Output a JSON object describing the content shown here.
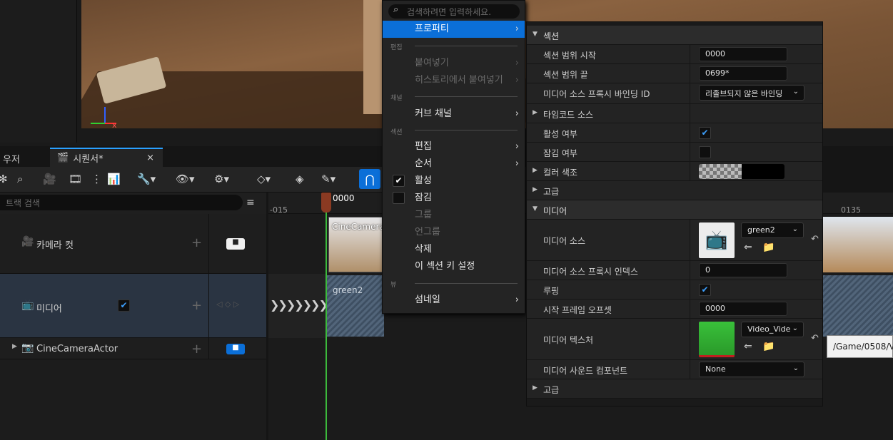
{
  "tabs": {
    "left_partial": "우저",
    "sequencer": "시퀀서*",
    "sequencer_icon": "clapperboard-icon",
    "close": "×"
  },
  "track_search": {
    "placeholder": "트랙 검색"
  },
  "tracks": [
    {
      "label": "카메라 컷",
      "icon": "camera-cut-icon"
    },
    {
      "label": "미디어",
      "icon": "tv-icon",
      "active_checked": true
    },
    {
      "label": "CineCameraActor",
      "icon": "camera-icon"
    }
  ],
  "ruler": {
    "start": "-015",
    "current": "0000",
    "end": "0135"
  },
  "clips": {
    "camera_clip": "CineCamera",
    "media_clip": "green2"
  },
  "context_menu": {
    "search_placeholder": "검색하려면 입력하세요.",
    "items": {
      "properties": "프로퍼티",
      "section_edit": "편집",
      "paste": "붙여넣기",
      "paste_history": "히스토리에서 붙여넣기",
      "section_channel": "채널",
      "curve_channel": "커브 채널",
      "section_section": "섹션",
      "edit": "편집",
      "order": "순서",
      "active": "활성",
      "lock": "잠김",
      "group": "그룹",
      "ungroup": "언그룹",
      "delete": "삭제",
      "key_section": "이 섹션 키 설정",
      "section_view": "뷰",
      "thumbnail": "섬네일"
    }
  },
  "details": {
    "section_header": "섹션",
    "range_start_label": "섹션 범위 시작",
    "range_start_value": "0000",
    "range_end_label": "섹션 범위 끝",
    "range_end_value": "0699*",
    "proxy_binding_label": "미디어 소스 프록시 바인딩 ID",
    "proxy_binding_value": "리졸브되지 않은 바인딩",
    "timecode_label": "타임코드 소스",
    "active_label": "활성 여부",
    "active_checked": true,
    "locked_label": "잠김 여부",
    "locked_checked": false,
    "color_tint_label": "컬러 색조",
    "advanced_1": "고급",
    "media_header": "미디어",
    "media_source_label": "미디어 소스",
    "media_source_value": "green2",
    "proxy_index_label": "미디어 소스 프록시 인덱스",
    "proxy_index_value": "0",
    "looping_label": "루핑",
    "looping_checked": true,
    "start_offset_label": "시작 프레임 오프셋",
    "start_offset_value": "0000",
    "media_texture_label": "미디어 텍스처",
    "media_texture_value": "Video_Vide",
    "sound_component_label": "미디어 사운드 컴포넌트",
    "sound_component_value": "None",
    "advanced_2": "고급"
  },
  "tooltip": "/Game/0508/V",
  "colors": {
    "accent": "#0b6fd8",
    "playhead": "#8a3a22",
    "playline": "#3cba3c"
  }
}
